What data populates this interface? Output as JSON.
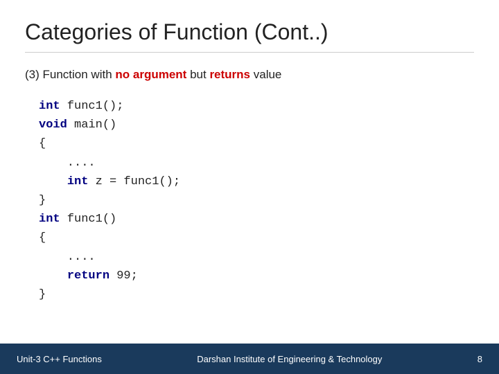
{
  "title": "Categories of Function (Cont..)",
  "divider": true,
  "subtitle": {
    "prefix": "(3) Function with ",
    "highlight1": "no argument",
    "middle": " but ",
    "highlight2": "returns",
    "suffix": " value"
  },
  "code": {
    "lines": [
      {
        "parts": [
          {
            "type": "kw",
            "text": "int"
          },
          {
            "type": "normal",
            "text": " func1();"
          }
        ]
      },
      {
        "parts": [
          {
            "type": "kw",
            "text": "void"
          },
          {
            "type": "normal",
            "text": " main()"
          }
        ]
      },
      {
        "parts": [
          {
            "type": "normal",
            "text": "{"
          }
        ]
      },
      {
        "parts": [
          {
            "type": "normal",
            "text": "    ...."
          }
        ]
      },
      {
        "parts": [
          {
            "type": "normal",
            "text": "    "
          },
          {
            "type": "kw",
            "text": "int"
          },
          {
            "type": "normal",
            "text": " z = func1();"
          }
        ]
      },
      {
        "parts": [
          {
            "type": "normal",
            "text": "}"
          }
        ]
      },
      {
        "parts": [
          {
            "type": "kw",
            "text": "int"
          },
          {
            "type": "normal",
            "text": " func1()"
          }
        ]
      },
      {
        "parts": [
          {
            "type": "normal",
            "text": "{"
          }
        ]
      },
      {
        "parts": [
          {
            "type": "normal",
            "text": "    ...."
          }
        ]
      },
      {
        "parts": [
          {
            "type": "normal",
            "text": "    "
          },
          {
            "type": "kw",
            "text": "return"
          },
          {
            "type": "normal",
            "text": " 99;"
          }
        ]
      },
      {
        "parts": [
          {
            "type": "normal",
            "text": "}"
          }
        ]
      }
    ]
  },
  "footer": {
    "left": "Unit-3 C++ Functions",
    "center": "Darshan Institute of Engineering & Technology",
    "right": "8"
  }
}
